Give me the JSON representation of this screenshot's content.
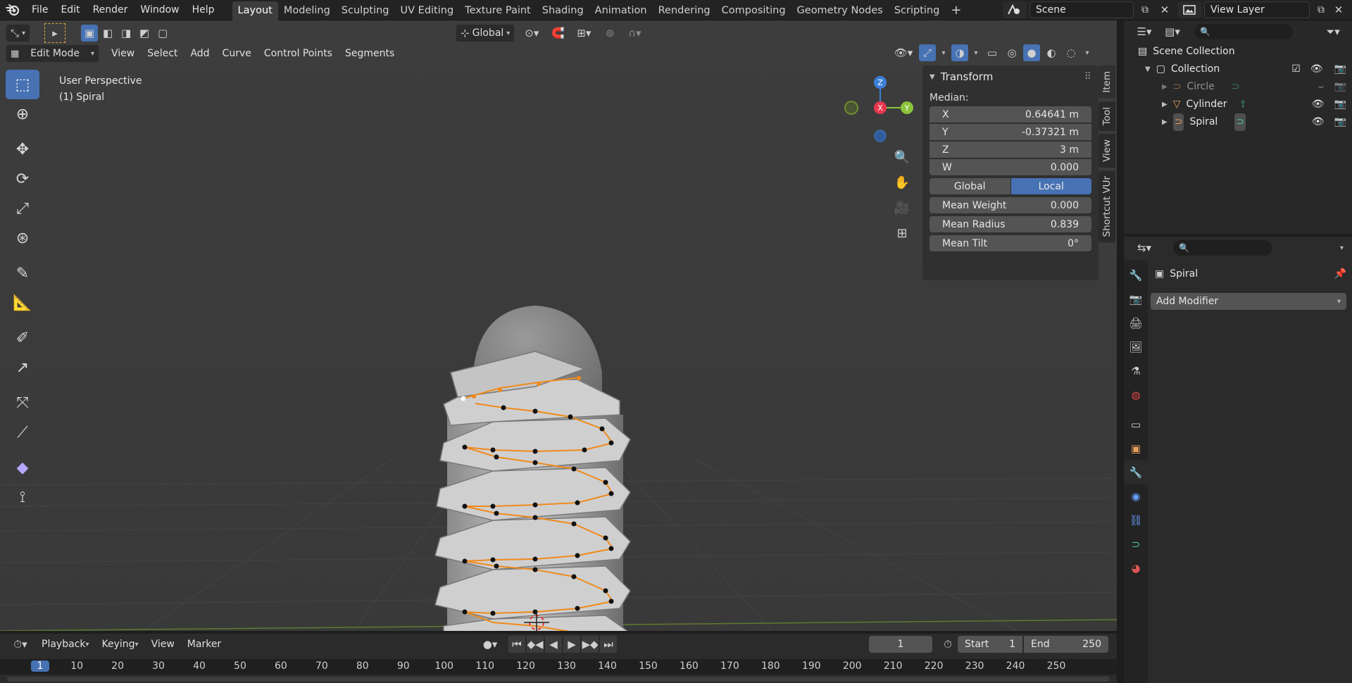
{
  "topbar": {
    "menus": [
      "File",
      "Edit",
      "Render",
      "Window",
      "Help"
    ],
    "workspaces": [
      "Layout",
      "Modeling",
      "Sculpting",
      "UV Editing",
      "Texture Paint",
      "Shading",
      "Animation",
      "Rendering",
      "Compositing",
      "Geometry Nodes",
      "Scripting"
    ],
    "active_workspace": "Layout",
    "add_tab": "+",
    "scene": "Scene",
    "view_layer": "View Layer"
  },
  "viewport_header": {
    "orientation": "Global",
    "mode": "Edit Mode",
    "menus": [
      "View",
      "Select",
      "Add",
      "Curve",
      "Control Points",
      "Segments"
    ]
  },
  "viewport": {
    "perspective": "User Perspective",
    "object": "(1) Spiral",
    "gizmo": {
      "z": "Z",
      "x": "X",
      "y": "Y"
    }
  },
  "npanel": {
    "title": "Transform",
    "median_label": "Median:",
    "fields": [
      {
        "label": "X",
        "value": "0.64641 m"
      },
      {
        "label": "Y",
        "value": "-0.37321 m"
      },
      {
        "label": "Z",
        "value": "3 m"
      },
      {
        "label": "W",
        "value": "0.000"
      }
    ],
    "global_label": "Global",
    "local_label": "Local",
    "mean_weight": {
      "label": "Mean Weight",
      "value": "0.000"
    },
    "mean_radius": {
      "label": "Mean Radius",
      "value": "0.839"
    },
    "mean_tilt": {
      "label": "Mean Tilt",
      "value": "0°"
    },
    "tabs": [
      "Item",
      "Tool",
      "View",
      "Shortcut VUr"
    ]
  },
  "outliner": {
    "scene_collection": "Scene Collection",
    "collection": "Collection",
    "items": [
      {
        "name": "Circle"
      },
      {
        "name": "Cylinder"
      },
      {
        "name": "Spiral"
      }
    ]
  },
  "properties": {
    "object_name": "Spiral",
    "add_modifier": "Add Modifier"
  },
  "timeline": {
    "menus": [
      "Playback",
      "Keying",
      "View",
      "Marker"
    ],
    "current_frame": "1",
    "start_label": "Start",
    "start_value": "1",
    "end_label": "End",
    "end_value": "250",
    "ruler": [
      "1",
      "10",
      "20",
      "30",
      "40",
      "50",
      "60",
      "70",
      "80",
      "90",
      "100",
      "110",
      "120",
      "130",
      "140",
      "150",
      "160",
      "170",
      "180",
      "190",
      "200",
      "210",
      "220",
      "230",
      "240",
      "250"
    ]
  },
  "colors": {
    "accent": "#4772b3",
    "curve": "#f08a1c",
    "axis_x": "#e8384f",
    "axis_y": "#8cc43c",
    "axis_z": "#3b7fd9"
  }
}
